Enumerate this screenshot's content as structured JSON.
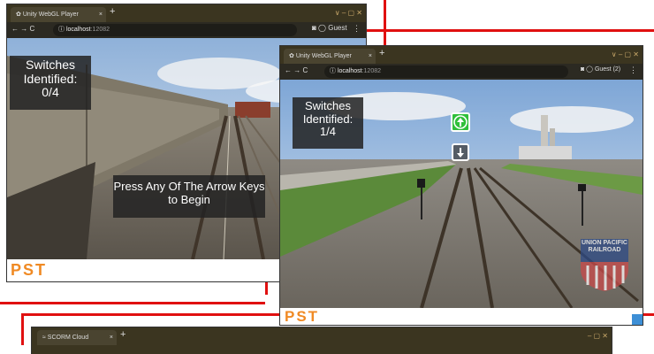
{
  "window_back": {
    "tab_title": "Unity WebGL Player",
    "tab_close": "×",
    "new_tab": "+",
    "window_controls": "∨   –   ▢   ✕",
    "nav": "←  →  C",
    "url_host": "localhost",
    "url_port": ":12082",
    "profile": "Guest",
    "counter_title": "Switches\nIdentified:",
    "counter_value": "0/4",
    "prompt": "Press Any Of The Arrow Keys to Begin",
    "footer_logo": "PST"
  },
  "window_front": {
    "tab_title": "Unity WebGL Player",
    "tab_close": "×",
    "new_tab": "+",
    "window_controls": "∨   –   ▢   ✕",
    "nav": "←  →  C",
    "url_host": "localhost",
    "url_port": ":12082",
    "profile": "Guest (2)",
    "counter_title": "Switches\nIdentified:",
    "counter_value": "1/4",
    "railroad_logo": "UNION PACIFIC RAILROAD",
    "footer_logo": "PST"
  },
  "window_bottom": {
    "tab_title": "SCORM Cloud",
    "tab_close": "×",
    "new_tab": "+",
    "window_controls": "–   ▢   ✕"
  },
  "colors": {
    "connector": "#e01010",
    "arrow_up_bg": "#2fbf3a",
    "pst_orange": "#f08a24",
    "chrome_dark": "#3b3520"
  }
}
